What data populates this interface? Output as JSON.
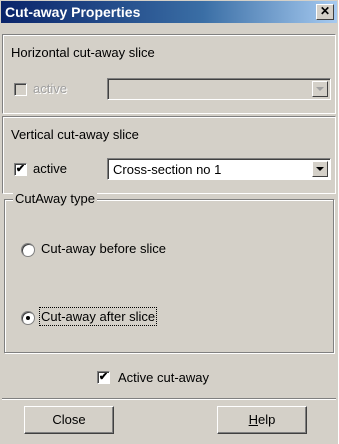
{
  "dialog": {
    "title": "Cut-away Properties",
    "close_glyph": "✕"
  },
  "horizontal": {
    "section_label": "Horizontal cut-away slice",
    "active_label": "active",
    "active_checked": false,
    "enabled": false,
    "selected_value": ""
  },
  "vertical": {
    "section_label": "Vertical cut-away slice",
    "active_label": "active",
    "active_checked": true,
    "selected_value": "Cross-section no 1"
  },
  "cutaway_type": {
    "group_label": "CutAway type",
    "options": [
      {
        "label": "Cut-away before slice",
        "selected": false
      },
      {
        "label": "Cut-away after slice",
        "selected": true
      }
    ]
  },
  "active_cutaway": {
    "label": "Active cut-away",
    "checked": true
  },
  "buttons": {
    "close": "Close",
    "help": "Help"
  },
  "icons": {
    "check": "✔",
    "radio_selected": "dot",
    "dropdown": "chevron-down-icon"
  }
}
